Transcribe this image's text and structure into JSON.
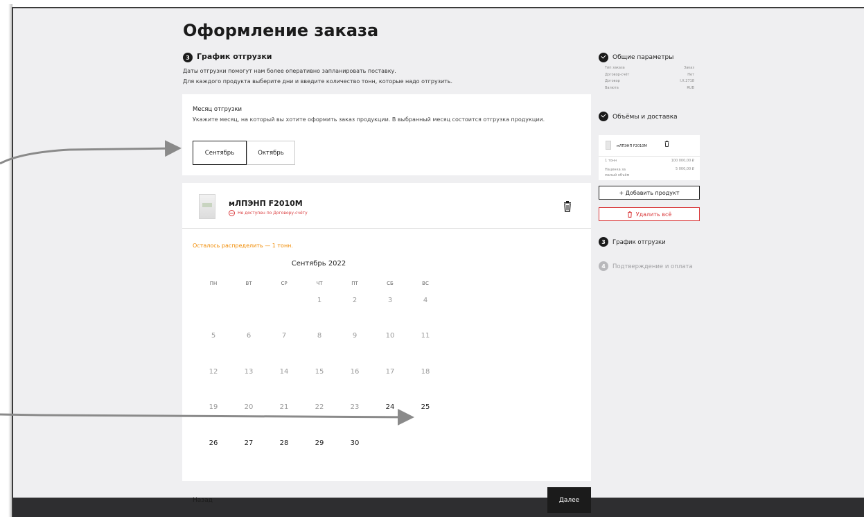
{
  "page": {
    "title": "Оформление заказа",
    "step_number": "3",
    "step_title": "График отгрузки",
    "description_line1": "Даты отгрузки помогут нам более оперативно запланировать поставку.",
    "description_line2": "Для каждого продукта выберите дни и введите количество тонн, которые надо отгрузить."
  },
  "month_selector": {
    "title": "Месяц отгрузки",
    "hint": "Укажите месяц, на который вы хотите оформить заказ продукции. В выбранный месяц состоится отгрузка продукции.",
    "options": [
      "Сентябрь",
      "Октябрь"
    ],
    "selected": "Сентябрь"
  },
  "product": {
    "name": "мЛПЭНП F2010M",
    "warning": "Не доступен по Договору-счёту",
    "remaining": "Осталось распределить — 1 тонн."
  },
  "calendar": {
    "title": "Сентябрь 2022",
    "weekdays": [
      "ПН",
      "ВТ",
      "СР",
      "ЧТ",
      "ПТ",
      "СБ",
      "ВС"
    ],
    "weeks": [
      [
        "",
        "",
        "",
        "1",
        "2",
        "3",
        "4"
      ],
      [
        "5",
        "6",
        "7",
        "8",
        "9",
        "10",
        "11"
      ],
      [
        "12",
        "13",
        "14",
        "15",
        "16",
        "17",
        "18"
      ],
      [
        "19",
        "20",
        "21",
        "22",
        "23",
        "24",
        "25"
      ],
      [
        "26",
        "27",
        "28",
        "29",
        "30",
        "",
        ""
      ]
    ],
    "available_from_day": 24
  },
  "sidebar": {
    "step1_title": "Общие параметры",
    "params": [
      {
        "label": "Тип заказа",
        "value": "Заказ"
      },
      {
        "label": "Договор-счёт",
        "value": "Нет"
      },
      {
        "label": "Договор",
        "value": "I.X.2718"
      },
      {
        "label": "Валюта",
        "value": "RUB"
      }
    ],
    "step2_title": "Объёмы и доставка",
    "cart_product": "мЛПЭНП F2010M",
    "quantity": "1 тонн",
    "price": "100 000,00 ₽",
    "surcharge_label": "Наценка за малый объём",
    "surcharge_price": "5 000,00 ₽",
    "add_product": "+ Добавить продукт",
    "delete_all": "Удалить всё",
    "step3_number": "3",
    "step3_title": "График отгрузки",
    "step4_number": "4",
    "step4_title": "Подтверждение и оплата"
  },
  "footer": {
    "back": "Назад",
    "next": "Далее"
  },
  "colors": {
    "accent": "#1b1b1b",
    "danger": "#d9383a",
    "warning": "#f08a00",
    "background": "#efeff1"
  }
}
